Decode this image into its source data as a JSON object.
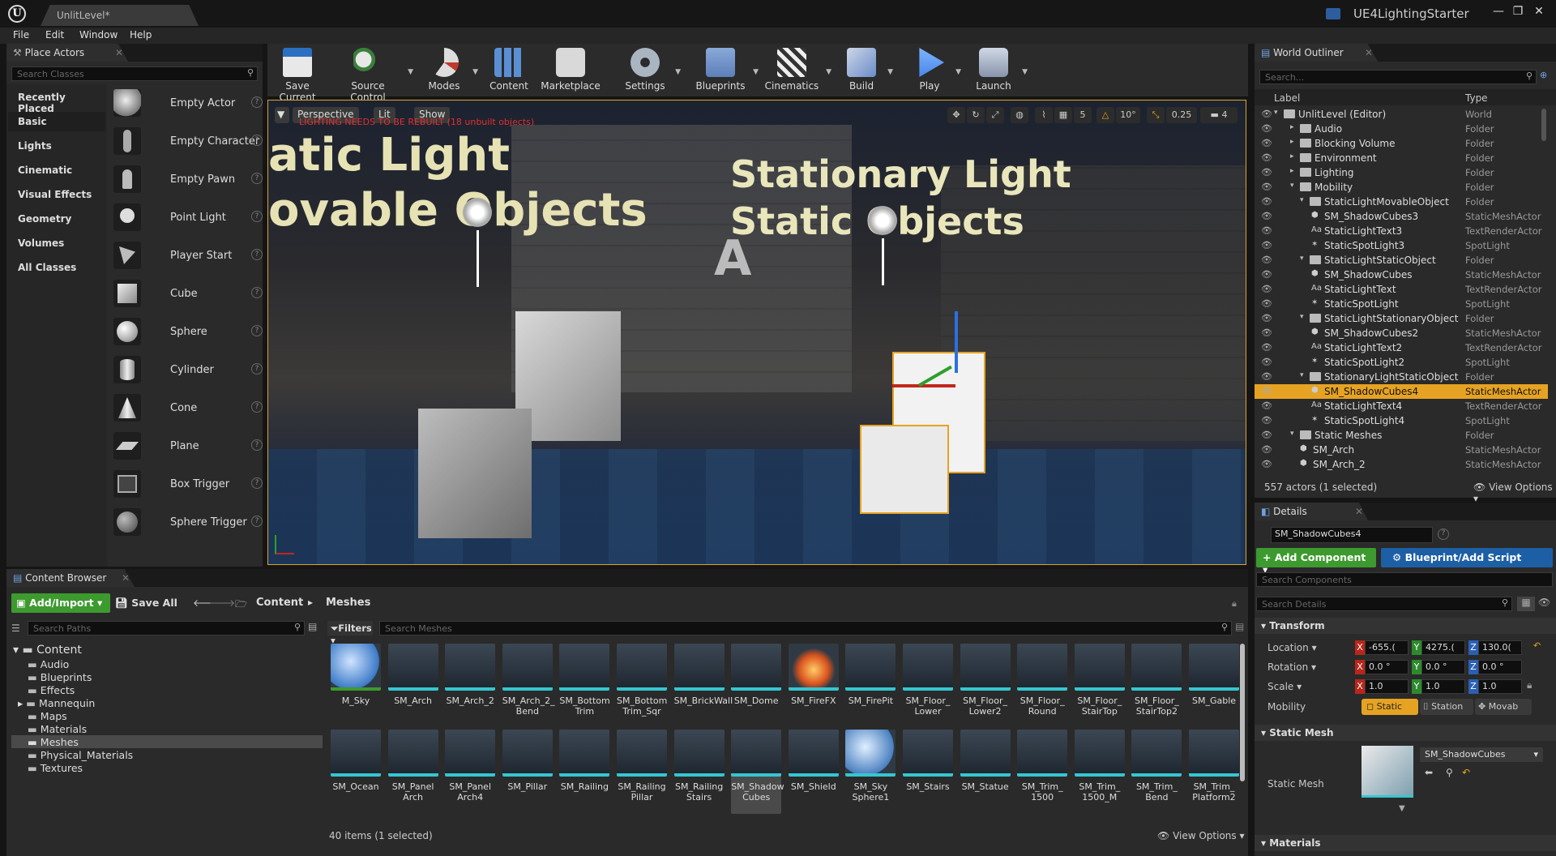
{
  "window": {
    "tab_title": "UnlitLevel*",
    "project_name": "UE4LightingStarter",
    "menu": [
      "File",
      "Edit",
      "Window",
      "Help"
    ]
  },
  "place_actors": {
    "tab_label": "Place Actors",
    "search_placeholder": "Search Classes",
    "categories": [
      "Recently Placed",
      "Basic",
      "Lights",
      "Cinematic",
      "Visual Effects",
      "Geometry",
      "Volumes",
      "All Classes"
    ],
    "selected_category": "Basic",
    "actors": [
      "Empty Actor",
      "Empty Character",
      "Empty Pawn",
      "Point Light",
      "Player Start",
      "Cube",
      "Sphere",
      "Cylinder",
      "Cone",
      "Plane",
      "Box Trigger",
      "Sphere Trigger"
    ]
  },
  "toolbar": {
    "buttons": [
      "Save Current",
      "Source Control",
      "Modes",
      "Content",
      "Marketplace",
      "Settings",
      "Blueprints",
      "Cinematics",
      "Build",
      "Play",
      "Launch"
    ]
  },
  "viewport": {
    "perspective": "Perspective",
    "lit": "Lit",
    "show": "Show",
    "warning": "LIGHTING NEEDS TO BE REBUILT (18 unbuilt objects)",
    "grid_snap": "5",
    "rot_snap": "10°",
    "scale_snap": "0.25",
    "cam_speed": "4",
    "scene_text_left_1": "atic Light",
    "scene_text_left_2": "ovable Objects",
    "scene_text_right_1": "Stationary Light",
    "scene_text_right_2": "Static Objects",
    "scene_letter": "A"
  },
  "outliner": {
    "tab_label": "World Outliner",
    "search_placeholder": "Search...",
    "col_label": "Label",
    "col_type": "Type",
    "rows": [
      {
        "name": "UnlitLevel (Editor)",
        "type": "World"
      },
      {
        "name": "Audio",
        "type": "Folder"
      },
      {
        "name": "Blocking Volume",
        "type": "Folder"
      },
      {
        "name": "Environment",
        "type": "Folder"
      },
      {
        "name": "Lighting",
        "type": "Folder"
      },
      {
        "name": "Mobility",
        "type": "Folder"
      },
      {
        "name": "StaticLightMovableObject",
        "type": "Folder"
      },
      {
        "name": "SM_ShadowCubes3",
        "type": "StaticMeshActor"
      },
      {
        "name": "StaticLightText3",
        "type": "TextRenderActor"
      },
      {
        "name": "StaticSpotLight3",
        "type": "SpotLight"
      },
      {
        "name": "StaticLightStaticObject",
        "type": "Folder"
      },
      {
        "name": "SM_ShadowCubes",
        "type": "StaticMeshActor"
      },
      {
        "name": "StaticLightText",
        "type": "TextRenderActor"
      },
      {
        "name": "StaticSpotLight",
        "type": "SpotLight"
      },
      {
        "name": "StaticLightStationaryObject",
        "type": "Folder"
      },
      {
        "name": "SM_ShadowCubes2",
        "type": "StaticMeshActor"
      },
      {
        "name": "StaticLightText2",
        "type": "TextRenderActor"
      },
      {
        "name": "StaticSpotLight2",
        "type": "SpotLight"
      },
      {
        "name": "StationaryLightStaticObject",
        "type": "Folder"
      },
      {
        "name": "SM_ShadowCubes4",
        "type": "StaticMeshActor"
      },
      {
        "name": "StaticLightText4",
        "type": "TextRenderActor"
      },
      {
        "name": "StaticSpotLight4",
        "type": "SpotLight"
      },
      {
        "name": "Static Meshes",
        "type": "Folder"
      },
      {
        "name": "SM_Arch",
        "type": "StaticMeshActor"
      },
      {
        "name": "SM_Arch_2",
        "type": "StaticMeshActor"
      }
    ],
    "status": "557 actors (1 selected)",
    "view_options": "View Options"
  },
  "details": {
    "tab_label": "Details",
    "actor_name": "SM_ShadowCubes4",
    "add_component": "+ Add Component",
    "blueprint_script": "Blueprint/Add Script",
    "search_components": "Search Components",
    "search_details": "Search Details",
    "transform_header": "Transform",
    "location_label": "Location",
    "rotation_label": "Rotation",
    "scale_label": "Scale",
    "mobility_label": "Mobility",
    "location": [
      "-655.(",
      "4275.(",
      "130.0("
    ],
    "rotation": [
      "0.0 °",
      "0.0 °",
      "0.0 °"
    ],
    "scale": [
      "1.0",
      "1.0",
      "1.0"
    ],
    "mobility": [
      "Static",
      "Station",
      "Movab"
    ],
    "static_mesh_header": "Static Mesh",
    "static_mesh_label": "Static Mesh",
    "static_mesh_value": "SM_ShadowCubes",
    "materials_header": "Materials"
  },
  "content_browser": {
    "tab_label": "Content Browser",
    "add_import": "Add/Import",
    "save_all": "Save All",
    "crumbs": [
      "Content",
      "Meshes"
    ],
    "search_paths": "Search Paths",
    "filters": "Filters",
    "search_assets": "Search Meshes",
    "tree": [
      "Content",
      "Audio",
      "Blueprints",
      "Effects",
      "Mannequin",
      "Maps",
      "Materials",
      "Meshes",
      "Physical_Materials",
      "Textures"
    ],
    "assets_row1": [
      "M_Sky",
      "SM_Arch",
      "SM_Arch_2",
      "SM_Arch_2_\nBend",
      "SM_Bottom\nTrim",
      "SM_Bottom\nTrim_Sqr",
      "SM_BrickWall",
      "SM_Dome",
      "SM_FireFX",
      "SM_FirePit",
      "SM_Floor_\nLower",
      "SM_Floor_\nLower2",
      "SM_Floor_\nRound",
      "SM_Floor_\nStairTop",
      "SM_Floor_\nStairTop2",
      "SM_Gable"
    ],
    "assets_row2": [
      "SM_Ocean",
      "SM_Panel\nArch",
      "SM_Panel\nArch4",
      "SM_Pillar",
      "SM_Railing",
      "SM_Railing\nPillar",
      "SM_Railing\nStairs",
      "SM_Shadow\nCubes",
      "SM_Shield",
      "SM_Sky\nSphere1",
      "SM_Stairs",
      "SM_Statue",
      "SM_Trim_\n1500",
      "SM_Trim_\n1500_M",
      "SM_Trim_\nBend",
      "SM_Trim_\nPlatform2"
    ],
    "status": "40 items (1 selected)",
    "view_options": "View Options"
  },
  "colors": {
    "selection": "#e6a323",
    "accent_green": "#3d9a2e",
    "accent_blue": "#1d5fa5",
    "asset_underline": "#35c6d0"
  }
}
